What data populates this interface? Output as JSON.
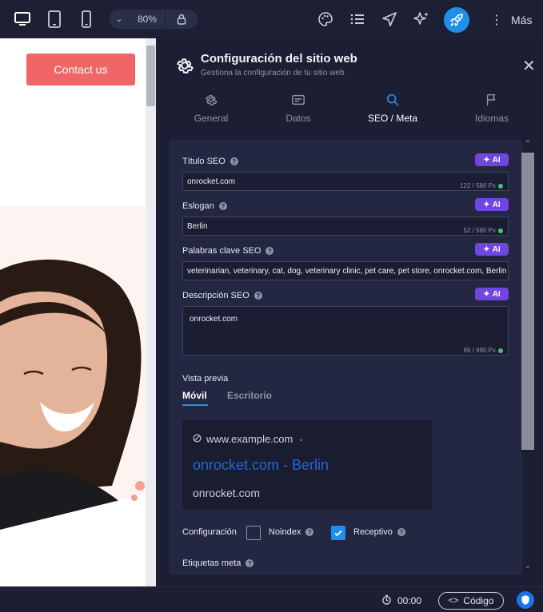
{
  "toolbar": {
    "zoom_value": "80%",
    "more_label": "Más",
    "accent_color": "#1e90e8"
  },
  "preview": {
    "contact_button_label": "Contact us",
    "contact_button_color": "#f06565"
  },
  "panel": {
    "title": "Configuración del sitio web",
    "subtitle": "Gestiona la configuración de tu sitio web",
    "tabs": [
      {
        "label": "General",
        "icon": "gear-icon"
      },
      {
        "label": "Datos",
        "icon": "card-icon"
      },
      {
        "label": "SEO / Meta",
        "icon": "search-icon"
      },
      {
        "label": "Idiomas",
        "icon": "flag-icon"
      }
    ],
    "active_tab": "SEO / Meta"
  },
  "seo": {
    "ai_label": "AI",
    "title_label": "Título SEO",
    "title_value": "onrocket.com",
    "title_counter": "122 / 580 Px",
    "slogan_label": "Eslogan",
    "slogan_value": "Berlin",
    "slogan_counter": "52 / 580 Px",
    "keywords_label": "Palabras clave SEO",
    "keywords_value": "veterinarian, veterinary, cat, dog, veterinary clinic, pet care, pet store, onrocket.com, Berlin",
    "description_label": "Descripción SEO",
    "description_value": "onrocket.com",
    "description_counter": "86 / 990 Px"
  },
  "preview_section": {
    "label": "Vista previa",
    "tabs": [
      "Móvil",
      "Escritorio"
    ],
    "active": "Móvil",
    "url": "www.example.com",
    "serp_title": "onrocket.com - Berlin",
    "serp_description": "onrocket.com"
  },
  "config": {
    "label": "Configuración",
    "noindex_label": "Noindex",
    "noindex_checked": false,
    "receptivo_label": "Receptivo",
    "receptivo_checked": true,
    "meta_tags_label": "Etiquetas meta"
  },
  "bottombar": {
    "timer": "00:00",
    "code_label": "Código"
  }
}
